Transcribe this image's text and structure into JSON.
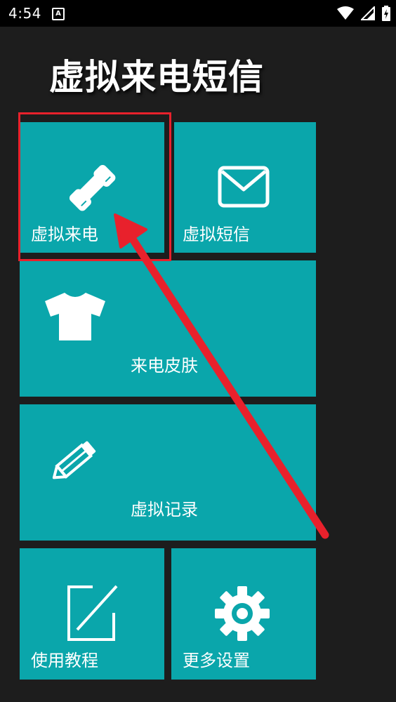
{
  "status_bar": {
    "time": "4:54",
    "notification_icon": "a-badge-icon",
    "icons": [
      "wifi-icon",
      "signal-icon",
      "battery-icon"
    ]
  },
  "app": {
    "title": "虚拟来电短信"
  },
  "tiles": [
    {
      "label": "虚拟来电",
      "icon": "phone-icon"
    },
    {
      "label": "虚拟短信",
      "icon": "envelope-icon"
    },
    {
      "label": "来电皮肤",
      "icon": "tshirt-icon"
    },
    {
      "label": "虚拟记录",
      "icon": "pencil-icon"
    },
    {
      "label": "使用教程",
      "icon": "edit-icon"
    },
    {
      "label": "更多设置",
      "icon": "gear-icon"
    }
  ],
  "colors": {
    "background": "#1d1d1d",
    "tile": "#0aa6ab",
    "annotation": "#e8212c"
  }
}
